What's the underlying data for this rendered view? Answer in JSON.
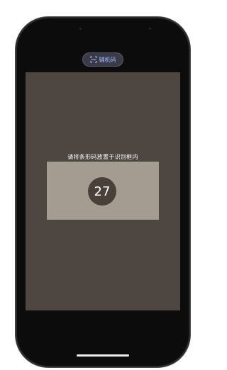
{
  "header": {
    "toggle_label": "辅机码",
    "toggle_icon": "scan-icon"
  },
  "scanner": {
    "hint": "请将条形码放置于识别框内",
    "countdown": "27"
  },
  "colors": {
    "camera_bg": "#4d4641",
    "scan_frame": "#a49c90",
    "countdown_bg": "#4a403a",
    "toggle_text": "#9fb8ff"
  }
}
